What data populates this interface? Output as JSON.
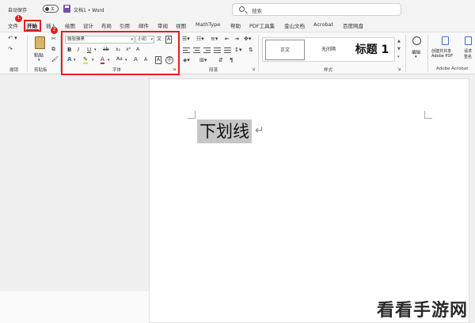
{
  "titlebar": {
    "autosave_label": "自动保存",
    "autosave_state": "关",
    "doc_name": "文档1 • Word",
    "search_placeholder": "搜索"
  },
  "tabs": [
    "文件",
    "开始",
    "插入",
    "绘图",
    "设计",
    "布局",
    "引用",
    "邮件",
    "审阅",
    "视图",
    "MathType",
    "帮助",
    "PDF工具集",
    "金山文档",
    "Acrobat",
    "百度网盘"
  ],
  "active_tab": "开始",
  "ribbon": {
    "undo_group_label": "撤销",
    "clipboard": {
      "paste_label": "粘贴",
      "group_label": "剪贴板"
    },
    "font": {
      "font_name": "微软雅黑",
      "font_size": "小初",
      "buttons": {
        "bold": "B",
        "italic": "I",
        "underline": "U",
        "strike": "ab",
        "subscript": "x₂",
        "superscript": "x²",
        "clear": "A",
        "font_color": "A",
        "change_case": "Aa",
        "grow": "A",
        "shrink": "A"
      },
      "group_label": "字体"
    },
    "paragraph": {
      "group_label": "段落"
    },
    "styles": {
      "items": [
        "正文",
        "无间隔",
        "标题 1"
      ],
      "group_label": "样式"
    },
    "editing": {
      "label": "编辑"
    },
    "adobe": {
      "create_share_label": "创建并共享",
      "create_share_sub": "Adobe PDF",
      "request_label": "请求",
      "request_sub": "签名",
      "group_label": "Adobe Acrobat"
    }
  },
  "annotations": {
    "badge_1": "1",
    "badge_2": "2"
  },
  "document": {
    "text": "下划线",
    "paragraph_mark": "↵"
  },
  "watermark": "看看手游网",
  "colors": {
    "accent": "#2b579a",
    "highlight": "#e02020",
    "selection": "#c6c6c6"
  }
}
